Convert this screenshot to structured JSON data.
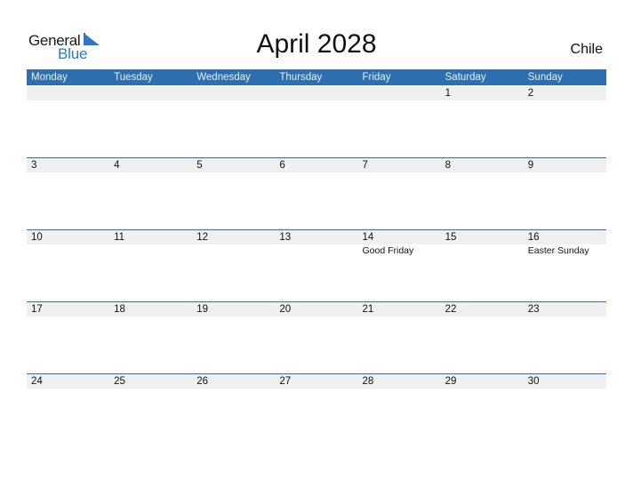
{
  "logo": {
    "line1": "General",
    "line2": "Blue"
  },
  "title": "April 2028",
  "country": "Chile",
  "colors": {
    "accent": "#2e6fb0",
    "strip": "#f0f0f0",
    "logo_blue": "#2b7bc0"
  },
  "weekdays": [
    "Monday",
    "Tuesday",
    "Wednesday",
    "Thursday",
    "Friday",
    "Saturday",
    "Sunday"
  ],
  "weeks": [
    {
      "days": [
        {
          "num": "",
          "event": ""
        },
        {
          "num": "",
          "event": ""
        },
        {
          "num": "",
          "event": ""
        },
        {
          "num": "",
          "event": ""
        },
        {
          "num": "",
          "event": ""
        },
        {
          "num": "1",
          "event": ""
        },
        {
          "num": "2",
          "event": ""
        }
      ]
    },
    {
      "days": [
        {
          "num": "3",
          "event": ""
        },
        {
          "num": "4",
          "event": ""
        },
        {
          "num": "5",
          "event": ""
        },
        {
          "num": "6",
          "event": ""
        },
        {
          "num": "7",
          "event": ""
        },
        {
          "num": "8",
          "event": ""
        },
        {
          "num": "9",
          "event": ""
        }
      ]
    },
    {
      "days": [
        {
          "num": "10",
          "event": ""
        },
        {
          "num": "11",
          "event": ""
        },
        {
          "num": "12",
          "event": ""
        },
        {
          "num": "13",
          "event": ""
        },
        {
          "num": "14",
          "event": "Good Friday"
        },
        {
          "num": "15",
          "event": ""
        },
        {
          "num": "16",
          "event": "Easter Sunday"
        }
      ]
    },
    {
      "days": [
        {
          "num": "17",
          "event": ""
        },
        {
          "num": "18",
          "event": ""
        },
        {
          "num": "19",
          "event": ""
        },
        {
          "num": "20",
          "event": ""
        },
        {
          "num": "21",
          "event": ""
        },
        {
          "num": "22",
          "event": ""
        },
        {
          "num": "23",
          "event": ""
        }
      ]
    },
    {
      "days": [
        {
          "num": "24",
          "event": ""
        },
        {
          "num": "25",
          "event": ""
        },
        {
          "num": "26",
          "event": ""
        },
        {
          "num": "27",
          "event": ""
        },
        {
          "num": "28",
          "event": ""
        },
        {
          "num": "29",
          "event": ""
        },
        {
          "num": "30",
          "event": ""
        }
      ]
    }
  ]
}
